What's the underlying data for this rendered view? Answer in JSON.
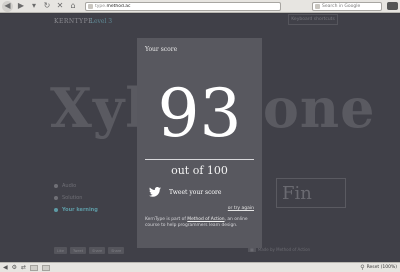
{
  "browser": {
    "url_prefix": "type.",
    "url_domain": "method.ac",
    "search_placeholder": "Search in Google",
    "zoom_label": "Reset (100%)"
  },
  "page": {
    "brand": "KERNTYPE",
    "level": "Level 3",
    "top_button": "Keyboard shortcuts",
    "big_word": "Xylophone",
    "side_items": [
      "Audio",
      "Solution",
      "Your kerning"
    ],
    "fin_word": "Fin",
    "share_buttons": [
      "Like",
      "Tweet",
      "Share",
      "Share"
    ],
    "credit": "Made by Method of Action"
  },
  "modal": {
    "title": "Your score",
    "score": "93",
    "out_of": "out of 100",
    "tweet_label": "Tweet your score",
    "try_again": "or try again",
    "about_pre": "KernType is part of ",
    "about_link": "Method of Action",
    "about_post": ", an online course to help programmers learn design."
  },
  "colors": {
    "overlay": "#404048",
    "modal_bg": "#58585f",
    "accent": "#5d9aa5"
  }
}
